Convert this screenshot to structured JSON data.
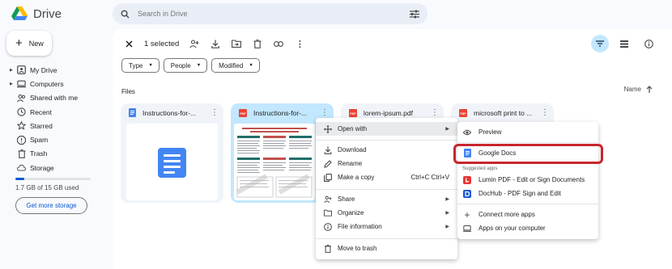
{
  "app": {
    "name": "Drive"
  },
  "search": {
    "placeholder": "Search in Drive"
  },
  "sidebar": {
    "new_label": "New",
    "items": [
      {
        "label": "My Drive",
        "icon": "my-drive-icon"
      },
      {
        "label": "Computers",
        "icon": "computers-icon"
      },
      {
        "label": "Shared with me",
        "icon": "shared-icon"
      },
      {
        "label": "Recent",
        "icon": "clock-icon"
      },
      {
        "label": "Starred",
        "icon": "star-icon"
      },
      {
        "label": "Spam",
        "icon": "spam-icon"
      },
      {
        "label": "Trash",
        "icon": "trash-icon"
      },
      {
        "label": "Storage",
        "icon": "cloud-icon"
      }
    ],
    "storage_used_fraction": 0.113,
    "storage_text": "1.7 GB of 15 GB used",
    "get_storage": "Get more storage"
  },
  "toolbar": {
    "selected_count": "1 selected"
  },
  "filters": [
    "Type",
    "People",
    "Modified"
  ],
  "files": {
    "section_label": "Files",
    "sort_label": "Name",
    "cards": [
      {
        "title": "Instructions-for-...",
        "type": "docs",
        "selected": false
      },
      {
        "title": "Instructions-for-...",
        "type": "pdf",
        "selected": true
      },
      {
        "title": "lorem-ipsum.pdf",
        "type": "pdf",
        "selected": false
      },
      {
        "title": "microsoft print to ...",
        "type": "pdf",
        "selected": false
      }
    ]
  },
  "context_menu": {
    "open_with": "Open with",
    "download": "Download",
    "rename": "Rename",
    "make_copy": "Make a copy",
    "make_copy_shortcut": "Ctrl+C Ctrl+V",
    "share": "Share",
    "organize": "Organize",
    "file_info": "File information",
    "move_trash": "Move to trash"
  },
  "open_with_menu": {
    "preview": "Preview",
    "google_docs": "Google Docs",
    "suggested_header": "Suggested apps",
    "lumin": "Lumin PDF - Edit or Sign Documents",
    "dochub": "DocHub - PDF Sign and Edit",
    "connect": "Connect more apps",
    "computer": "Apps on your computer"
  },
  "colors": {
    "accent": "#0b57d0",
    "selected_bg": "#c2e7ff",
    "docs_blue": "#4285f4",
    "pdf_red": "#ea4335",
    "highlight_ring": "#c8262d"
  }
}
